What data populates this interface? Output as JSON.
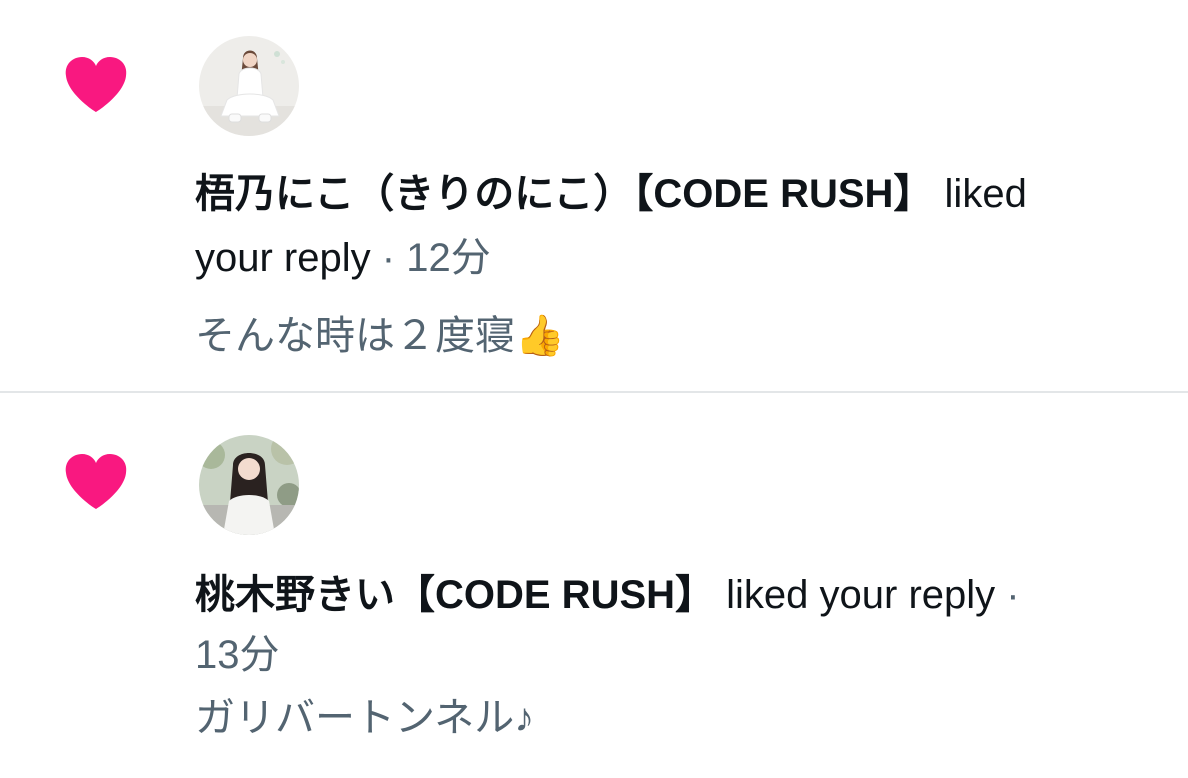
{
  "notifications": [
    {
      "user_name": "梧乃にこ（きりのにこ）【CODE RUSH】",
      "action_word_1": "liked",
      "action_word_2": "your reply",
      "separator": "·",
      "time": "12分",
      "reply_text": "そんな時は２度寝👍",
      "icon": "heart-icon",
      "icon_color": "#f91880"
    },
    {
      "user_name": "桃木野きい【CODE RUSH】",
      "action": "liked your reply",
      "separator": "·",
      "time": "13分",
      "reply_text": "ガリバートンネル♪",
      "icon": "heart-icon",
      "icon_color": "#f91880"
    }
  ],
  "colors": {
    "heart": "#f91880",
    "primary_text": "#0f1419",
    "secondary_text": "#536471",
    "divider": "#e3e6e8"
  }
}
